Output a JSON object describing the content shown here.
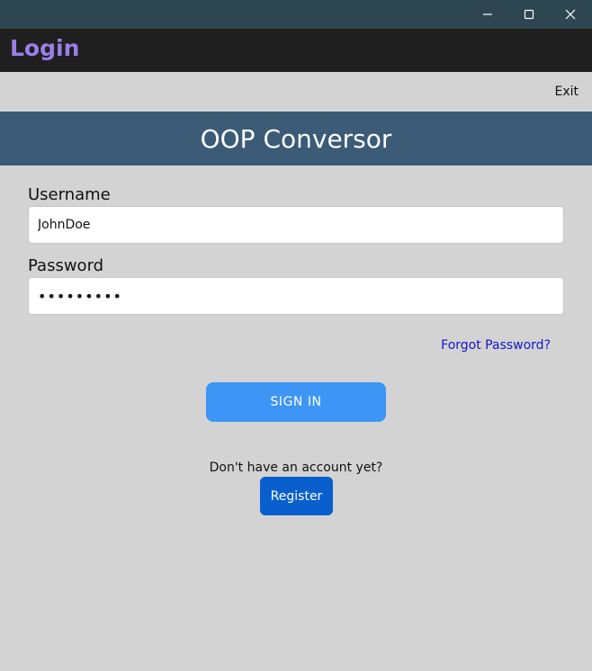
{
  "window": {
    "controls": [
      {
        "name": "minimize",
        "icon": "minimize-icon"
      },
      {
        "name": "maximize",
        "icon": "maximize-icon"
      },
      {
        "name": "close",
        "icon": "close-icon"
      }
    ]
  },
  "app": {
    "title": "Login",
    "title_color": "#9b7fe8"
  },
  "menu": {
    "exit_label": "Exit"
  },
  "header": {
    "title": "OOP Conversor",
    "background": "#3b5b77"
  },
  "form": {
    "username_label": "Username",
    "username_value": "JohnDoe",
    "password_label": "Password",
    "password_value": "•••••••••",
    "forgot_link": "Forgot Password?",
    "signin_label": "SIGN IN",
    "no_account_text": "Don't have an account yet?",
    "register_label": "Register"
  },
  "colors": {
    "signin_button": "#3d95f5",
    "register_button": "#0a5fcf",
    "link": "#1515c8",
    "background": "#d3d3d3"
  }
}
